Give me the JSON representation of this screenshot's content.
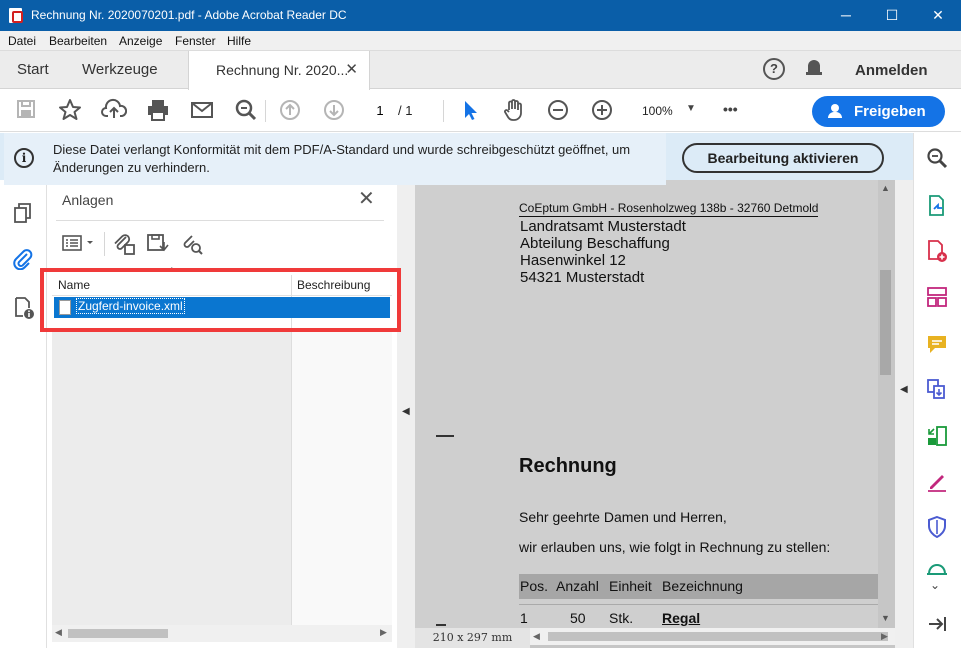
{
  "window": {
    "title": "Rechnung Nr. 2020070201.pdf - Adobe Acrobat Reader DC",
    "minimize": "─",
    "maximize": "☐",
    "close": "✕"
  },
  "menu": [
    "Datei",
    "Bearbeiten",
    "Anzeige",
    "Fenster",
    "Hilfe"
  ],
  "tabs": {
    "start": "Start",
    "tools": "Werkzeuge",
    "document": "Rechnung Nr. 2020...",
    "close": "✕"
  },
  "header": {
    "help": "?",
    "signin": "Anmelden"
  },
  "toolbar": {
    "page_current": "1",
    "page_sep_total": "/ 1",
    "zoom": "100%",
    "more": "•••",
    "share": "Freigeben"
  },
  "notice": {
    "text": "Diese Datei verlangt Konformität mit dem PDF/A-Standard und wurde schreibgeschützt geöffnet, um Änderungen zu verhindern.",
    "button": "Bearbeitung aktivieren"
  },
  "panel": {
    "title": "Anlagen",
    "close": "✕",
    "columns": {
      "name": "Name",
      "description": "Beschreibung"
    },
    "files": [
      {
        "name": "Zugferd-invoice.xml",
        "description": "",
        "selected": true
      }
    ]
  },
  "document": {
    "page_size": "210 x 297 mm",
    "sender": "CoEptum GmbH - Rosenholzweg 138b - 32760 Detmold",
    "address": [
      "Landratsamt Musterstadt",
      "Abteilung Beschaffung",
      "Hasenwinkel 12",
      "54321 Musterstadt"
    ],
    "title": "Rechnung",
    "greeting": "Sehr geehrte Damen und Herren,",
    "intro": "wir erlauben uns, wie folgt in Rechnung zu stellen:",
    "table": {
      "headers": [
        "Pos.",
        "Anzahl",
        "Einheit",
        "Bezeichnung"
      ],
      "rows": [
        [
          "1",
          "50",
          "Stk.",
          "Regal"
        ]
      ]
    }
  },
  "colors": {
    "titlebar": "#0a5ea8",
    "accent": "#1473e6",
    "highlight": "#f03a3a",
    "selection": "#0a76d0"
  }
}
